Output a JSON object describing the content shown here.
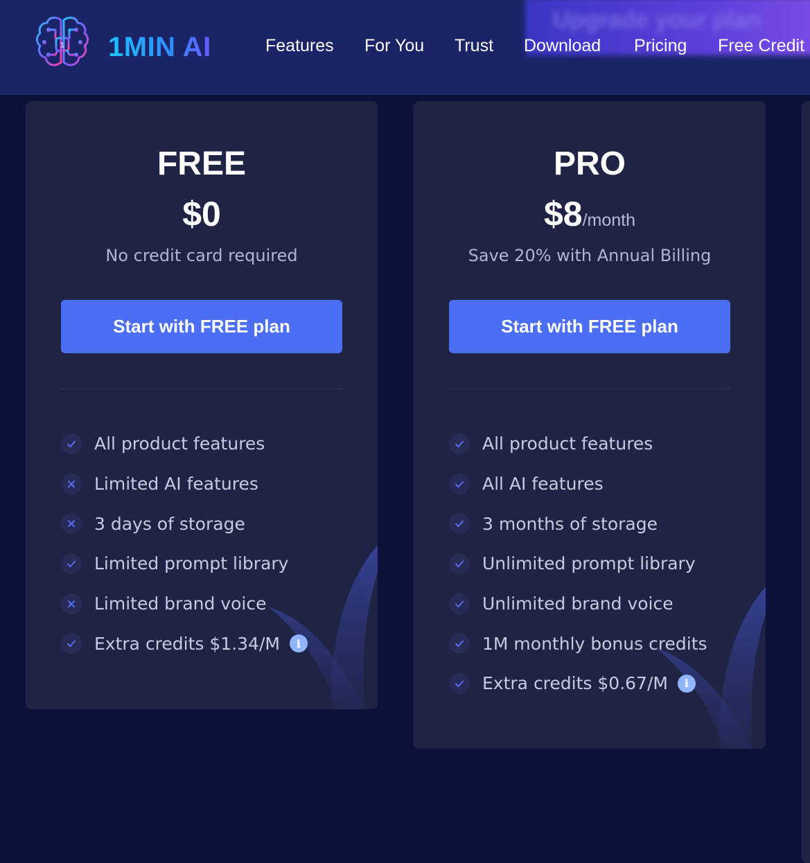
{
  "header": {
    "logo_text": "1MIN AI",
    "nav": [
      "Features",
      "For You",
      "Trust",
      "Download",
      "Pricing",
      "Free Credit"
    ],
    "promo_text": "Upgrade your plan"
  },
  "plans": [
    {
      "name": "FREE",
      "price": "$0",
      "period": "",
      "subtitle": "No credit card required",
      "cta": "Start with FREE plan",
      "features": [
        {
          "text": "All product features",
          "status": "check"
        },
        {
          "text": "Limited AI features",
          "status": "cross"
        },
        {
          "text": "3 days of storage",
          "status": "cross"
        },
        {
          "text": "Limited prompt library",
          "status": "check"
        },
        {
          "text": "Limited brand voice",
          "status": "cross"
        },
        {
          "text": "Extra credits $1.34/M",
          "status": "check",
          "info": "i"
        }
      ]
    },
    {
      "name": "PRO",
      "price": "$8",
      "period": "/month",
      "subtitle": "Save 20% with Annual Billing",
      "cta": "Start with FREE plan",
      "features": [
        {
          "text": "All product features",
          "status": "check"
        },
        {
          "text": "All AI features",
          "status": "check"
        },
        {
          "text": "3 months of storage",
          "status": "check"
        },
        {
          "text": "Unlimited prompt library",
          "status": "check"
        },
        {
          "text": "Unlimited brand voice",
          "status": "check"
        },
        {
          "text": "1M monthly bonus credits",
          "status": "check"
        },
        {
          "text": "Extra credits $0.67/M",
          "status": "check",
          "info": "i"
        }
      ]
    }
  ],
  "icons": {
    "logo": "brain-chip-icon",
    "check": "check-icon",
    "cross": "cross-icon",
    "info": "info-icon"
  },
  "colors": {
    "background": "#0b1138",
    "header": "#1a2466",
    "card": "#1f2344",
    "button": "#4c6ef5",
    "icon_accent": "#5b6cf0"
  }
}
